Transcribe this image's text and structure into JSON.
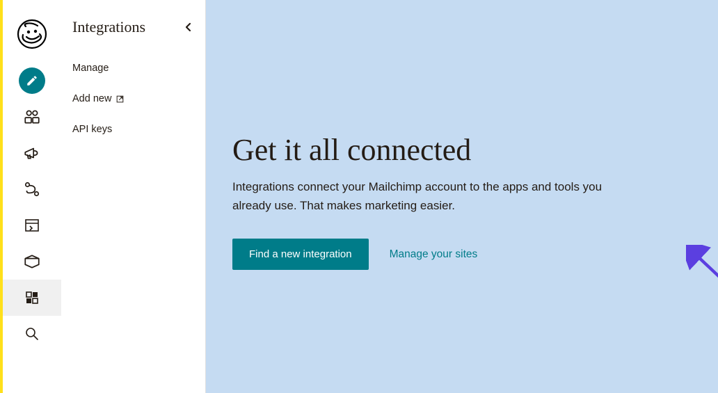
{
  "subnav": {
    "title": "Integrations",
    "items": [
      {
        "label": "Manage"
      },
      {
        "label": "Add new",
        "external": true
      },
      {
        "label": "API keys"
      }
    ]
  },
  "main": {
    "heading": "Get it all connected",
    "subtitle": "Integrations connect your Mailchimp account to the apps and tools you already use. That makes marketing easier.",
    "primary_cta": "Find a new integration",
    "secondary_cta": "Manage your sites"
  },
  "colors": {
    "accent": "#007c89",
    "brand_yellow": "#ffe01b",
    "hero_bg": "#c5dbf2",
    "annotation": "#5b3fe0"
  }
}
